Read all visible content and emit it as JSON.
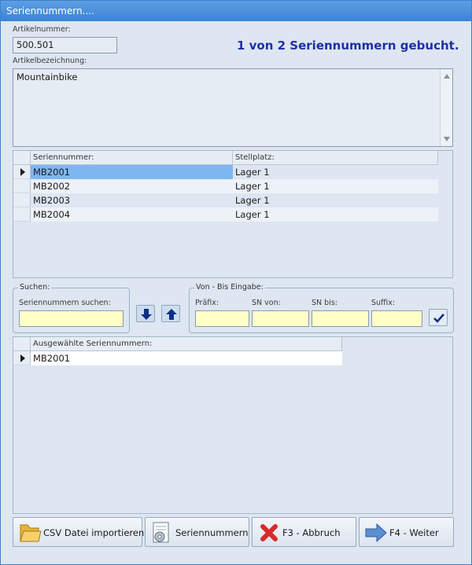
{
  "window": {
    "title": "Seriennummern...."
  },
  "article": {
    "number_label": "Artikelnummer:",
    "number_value": "500.501",
    "desc_label": "Artikelbezeichnung:",
    "desc_value": "Mountainbike",
    "status_message": "1 von 2 Seriennummern gebucht."
  },
  "serial_grid": {
    "columns": [
      "Seriennummer:",
      "Stellplatz:"
    ],
    "rows": [
      {
        "serial": "MB2001",
        "location": "Lager 1",
        "selected": true
      },
      {
        "serial": "MB2002",
        "location": "Lager 1",
        "selected": false
      },
      {
        "serial": "MB2003",
        "location": "Lager 1",
        "selected": false
      },
      {
        "serial": "MB2004",
        "location": "Lager 1",
        "selected": false
      }
    ]
  },
  "search": {
    "group_label": "Suchen:",
    "field_label": "Seriennummern suchen:",
    "value": ""
  },
  "range": {
    "group_label": "Von - Bis Eingabe:",
    "prefix_label": "Präfix:",
    "from_label": "SN von:",
    "to_label": "SN bis:",
    "suffix_label": "Suffix:"
  },
  "selected_grid": {
    "column": "Ausgewählte Seriennummern:",
    "rows": [
      {
        "serial": "MB2001"
      }
    ]
  },
  "buttons": {
    "import_csv": "CSV Datei importieren",
    "serials": "Seriennummern",
    "cancel": "F3 - Abbruch",
    "next": "F4 - Weiter"
  },
  "colors": {
    "accent": "#3a83d6",
    "status_text": "#1f2fa8",
    "selected_row": "#7eb6f2",
    "input_yellow": "#ffffc6"
  }
}
